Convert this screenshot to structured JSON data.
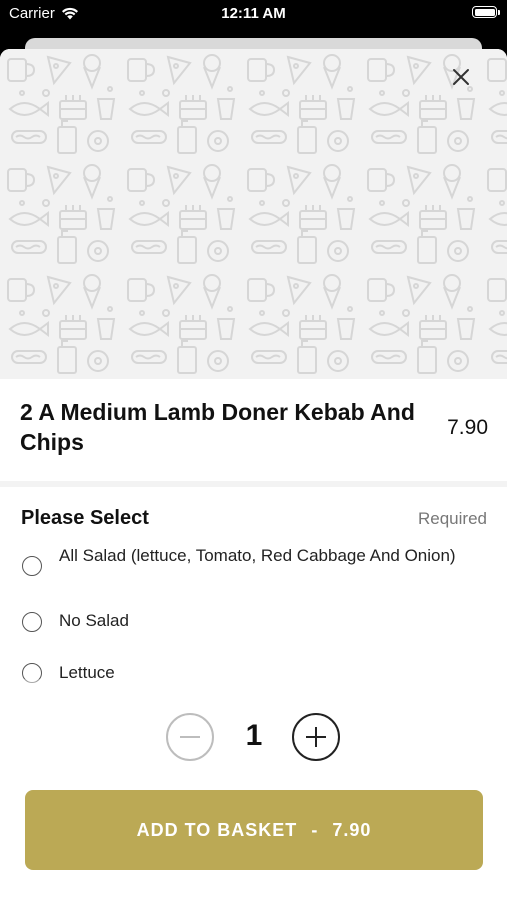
{
  "status_bar": {
    "carrier": "Carrier",
    "time": "12:11 AM",
    "icons": [
      "wifi-icon",
      "battery-icon"
    ]
  },
  "modal": {
    "close_icon": "close-icon",
    "item": {
      "title": "2 A Medium Lamb Doner Kebab And Chips",
      "price": "7.90"
    },
    "options_group": {
      "header": "Please Select",
      "required_label": "Required",
      "options": [
        {
          "label": "All Salad (lettuce, Tomato, Red Cabbage And Onion)",
          "selected": false
        },
        {
          "label": "No Salad",
          "selected": false
        },
        {
          "label": "Lettuce",
          "selected": false
        }
      ]
    },
    "quantity": {
      "value": "1",
      "minus_icon": "minus-icon",
      "plus_icon": "plus-icon"
    },
    "add_button": {
      "label": "ADD TO BASKET",
      "separator": "-",
      "price": "7.90"
    }
  },
  "colors": {
    "accent": "#bba955",
    "hero_bg": "#f2f2f2",
    "status_bar_bg": "#000000"
  }
}
